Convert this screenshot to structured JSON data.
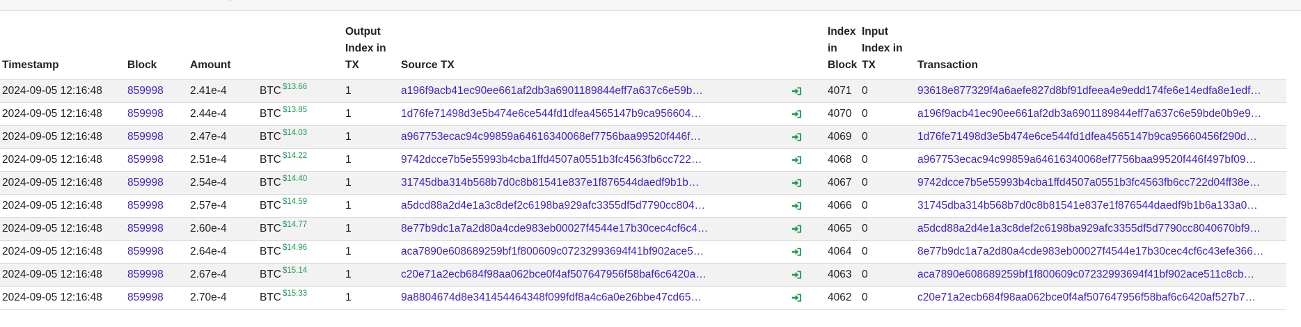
{
  "headers": {
    "timestamp": "Timestamp",
    "block": "Block",
    "amount": "Amount",
    "output_index": "Output Index in TX",
    "source_tx": "Source TX",
    "index_in_block": "Index in Block",
    "input_index": "Input Index in TX",
    "transaction": "Transaction"
  },
  "colors": {
    "link": "#3f1fd1",
    "usd": "#1e9b56",
    "icon": "#1e9b56"
  },
  "icon": "sign-in-icon",
  "rows": [
    {
      "timestamp": "2024-09-05 12:16:48",
      "block": "859998",
      "amount": "2.41e-4",
      "unit": "BTC",
      "usd": "$13.66",
      "output_index": "1",
      "source_tx": "a196f9acb41ec90ee661af2db3a6901189844eff7a637c6e59b…",
      "index_in_block": "4071",
      "input_index": "0",
      "transaction": "93618e877329f4a6aefe827d8bf91dfeea4e9edd174fe6e14edfa8e1edf…"
    },
    {
      "timestamp": "2024-09-05 12:16:48",
      "block": "859998",
      "amount": "2.44e-4",
      "unit": "BTC",
      "usd": "$13.85",
      "output_index": "1",
      "source_tx": "1d76fe71498d3e5b474e6ce544fd1dfea4565147b9ca956604…",
      "index_in_block": "4070",
      "input_index": "0",
      "transaction": "a196f9acb41ec90ee661af2db3a6901189844eff7a637c6e59bde0b9e9…"
    },
    {
      "timestamp": "2024-09-05 12:16:48",
      "block": "859998",
      "amount": "2.47e-4",
      "unit": "BTC",
      "usd": "$14.03",
      "output_index": "1",
      "source_tx": "a967753ecac94c99859a64616340068ef7756baa99520f446f…",
      "index_in_block": "4069",
      "input_index": "0",
      "transaction": "1d76fe71498d3e5b474e6ce544fd1dfea4565147b9ca95660456f290d…"
    },
    {
      "timestamp": "2024-09-05 12:16:48",
      "block": "859998",
      "amount": "2.51e-4",
      "unit": "BTC",
      "usd": "$14.22",
      "output_index": "1",
      "source_tx": "9742dcce7b5e55993b4cba1ffd4507a0551b3fc4563fb6cc722…",
      "index_in_block": "4068",
      "input_index": "0",
      "transaction": "a967753ecac94c99859a64616340068ef7756baa99520f446f497bf09…"
    },
    {
      "timestamp": "2024-09-05 12:16:48",
      "block": "859998",
      "amount": "2.54e-4",
      "unit": "BTC",
      "usd": "$14.40",
      "output_index": "1",
      "source_tx": "31745dba314b568b7d0c8b81541e837e1f876544daedf9b1b…",
      "index_in_block": "4067",
      "input_index": "0",
      "transaction": "9742dcce7b5e55993b4cba1ffd4507a0551b3fc4563fb6cc722d04ff38e…"
    },
    {
      "timestamp": "2024-09-05 12:16:48",
      "block": "859998",
      "amount": "2.57e-4",
      "unit": "BTC",
      "usd": "$14.59",
      "output_index": "1",
      "source_tx": "a5dcd88a2d4e1a3c8def2c6198ba929afc3355df5d7790cc804…",
      "index_in_block": "4066",
      "input_index": "0",
      "transaction": "31745dba314b568b7d0c8b81541e837e1f876544daedf9b1b6a133a0…"
    },
    {
      "timestamp": "2024-09-05 12:16:48",
      "block": "859998",
      "amount": "2.60e-4",
      "unit": "BTC",
      "usd": "$14.77",
      "output_index": "1",
      "source_tx": "8e77b9dc1a7a2d80a4cde983eb00027f4544e17b30cec4cf6c4…",
      "index_in_block": "4065",
      "input_index": "0",
      "transaction": "a5dcd88a2d4e1a3c8def2c6198ba929afc3355df5d7790cc8040670bf9…"
    },
    {
      "timestamp": "2024-09-05 12:16:48",
      "block": "859998",
      "amount": "2.64e-4",
      "unit": "BTC",
      "usd": "$14.96",
      "output_index": "1",
      "source_tx": "aca7890e608689259bf1f800609c07232993694f41bf902ace5…",
      "index_in_block": "4064",
      "input_index": "0",
      "transaction": "8e77b9dc1a7a2d80a4cde983eb00027f4544e17b30cec4cf6c43efe366…"
    },
    {
      "timestamp": "2024-09-05 12:16:48",
      "block": "859998",
      "amount": "2.67e-4",
      "unit": "BTC",
      "usd": "$15.14",
      "output_index": "1",
      "source_tx": "c20e71a2ecb684f98aa062bce0f4af507647956f58baf6c6420a…",
      "index_in_block": "4063",
      "input_index": "0",
      "transaction": "aca7890e608689259bf1f800609c07232993694f41bf902ace511c8cb…"
    },
    {
      "timestamp": "2024-09-05 12:16:48",
      "block": "859998",
      "amount": "2.70e-4",
      "unit": "BTC",
      "usd": "$15.33",
      "output_index": "1",
      "source_tx": "9a8804674d8e341454464348f099fdf8a4c6a0e26bbe47cd65…",
      "index_in_block": "4062",
      "input_index": "0",
      "transaction": "c20e71a2ecb684f98aa062bce0f4af507647956f58baf6c6420af527b7…"
    }
  ]
}
